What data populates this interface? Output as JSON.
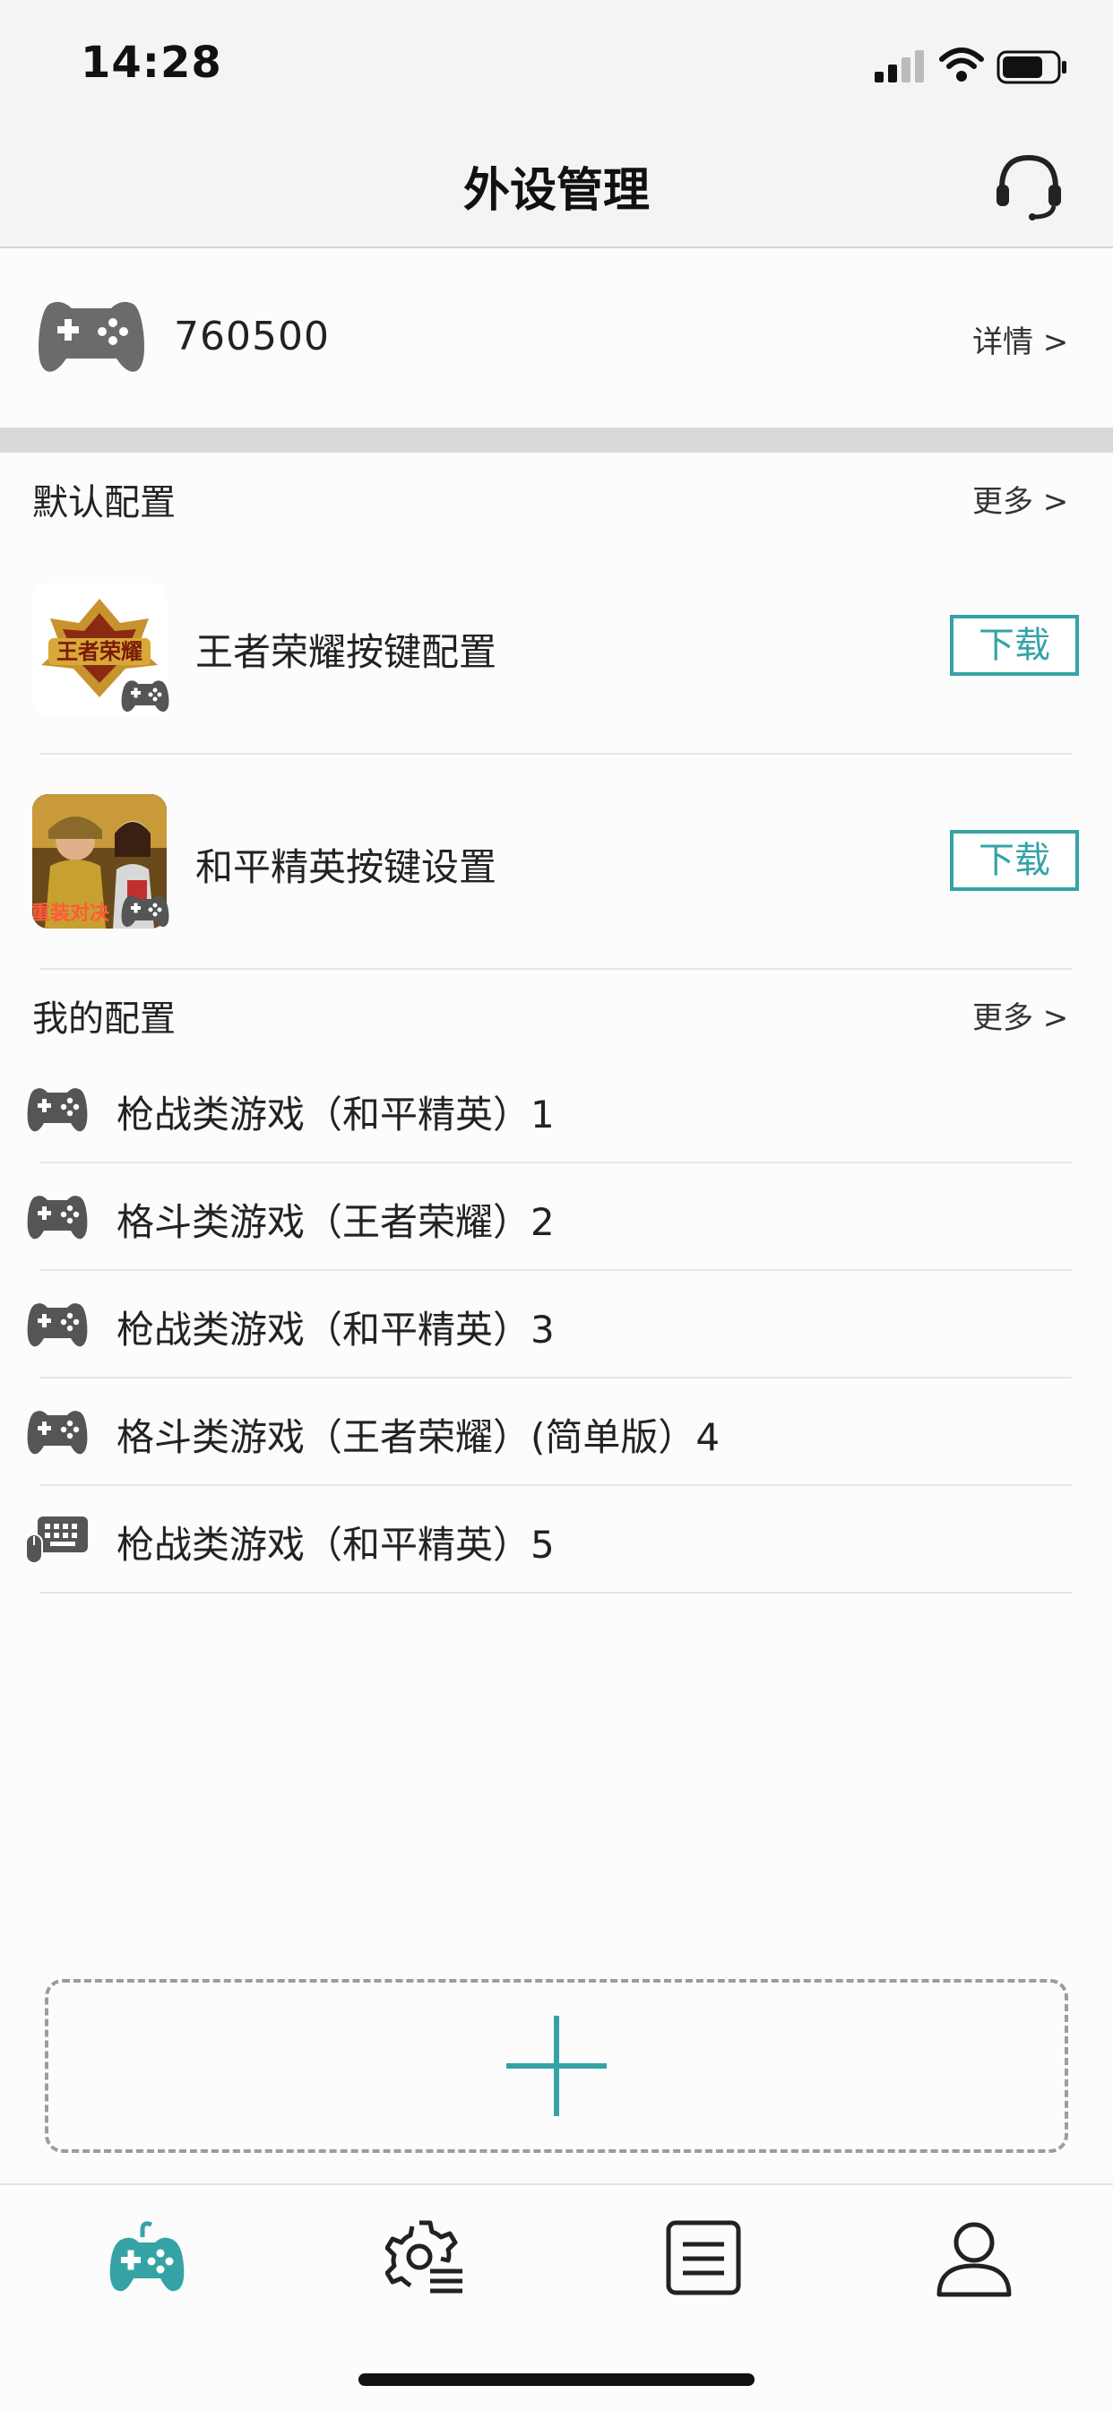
{
  "status_bar": {
    "time": "14:28"
  },
  "header": {
    "title": "外设管理"
  },
  "device": {
    "name": "760500",
    "detail_label": "详情  >"
  },
  "default_configs": {
    "title": "默认配置",
    "more_label": "更多  >",
    "items": [
      {
        "name": "王者荣耀按键配置",
        "button_label": "下载",
        "thumb_text": "王者荣耀"
      },
      {
        "name": "和平精英按键设置",
        "button_label": "下载",
        "thumb_text": "重装对决"
      }
    ]
  },
  "my_configs": {
    "title": "我的配置",
    "more_label": "更多  >",
    "items": [
      {
        "text": "枪战类游戏（和平精英）1",
        "icon": "gamepad-icon"
      },
      {
        "text": "格斗类游戏（王者荣耀）2",
        "icon": "gamepad-icon"
      },
      {
        "text": "枪战类游戏（和平精英）3",
        "icon": "gamepad-icon"
      },
      {
        "text": "格斗类游戏（王者荣耀）(简单版）4",
        "icon": "gamepad-icon"
      },
      {
        "text": "枪战类游戏（和平精英）5",
        "icon": "keyboard-mouse-icon"
      }
    ]
  },
  "tabs": [
    {
      "icon": "gamepad-tab-icon",
      "active": true
    },
    {
      "icon": "settings-list-icon",
      "active": false
    },
    {
      "icon": "document-icon",
      "active": false
    },
    {
      "icon": "user-icon",
      "active": false
    }
  ],
  "colors": {
    "accent": "#35a3a6",
    "icon_gray": "#555555"
  }
}
